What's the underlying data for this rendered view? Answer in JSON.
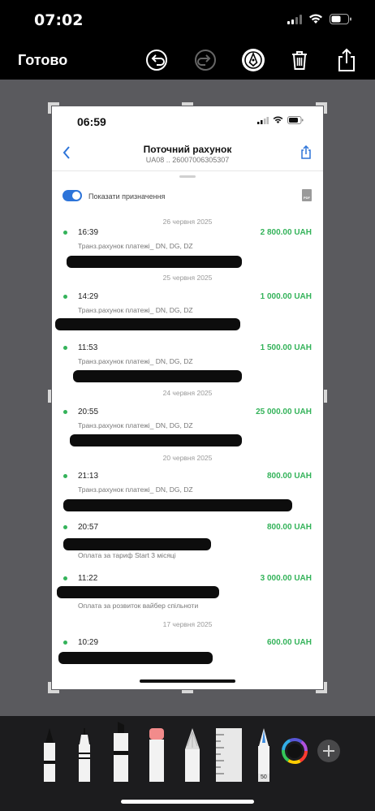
{
  "status_bar": {
    "time": "07:02"
  },
  "toolbar": {
    "done_label": "Готово"
  },
  "document": {
    "status_time": "06:59",
    "header": {
      "title": "Поточний рахунок",
      "subtitle": "UA08 .. 26007006305307"
    },
    "toggle_label": "Показати призначення",
    "pdf_label": "PDF",
    "dates": [
      "26 червня 2025",
      "25 червня 2025",
      "24 червня 2025",
      "20 червня 2025",
      "17 червня 2025"
    ],
    "transactions": [
      {
        "time": "16:39",
        "amount": "2 800.00 UAH",
        "desc": "Транз.рахунок платежі_ DN, DG, DZ"
      },
      {
        "time": "14:29",
        "amount": "1 000.00 UAH",
        "desc": "Транз.рахунок платежі_ DN, DG, DZ"
      },
      {
        "time": "11:53",
        "amount": "1 500.00 UAH",
        "desc": "Транз.рахунок платежі_ DN, DG, DZ"
      },
      {
        "time": "20:55",
        "amount": "25 000.00 UAH",
        "desc": "Транз.рахунок платежі_ DN, DG, DZ"
      },
      {
        "time": "21:13",
        "amount": "800.00 UAH",
        "desc": "Транз.рахунок платежі_ DN, DG, DZ"
      },
      {
        "time": "20:57",
        "amount": "800.00 UAH",
        "desc": "Оплата за тариф Start 3 місяці"
      },
      {
        "time": "11:22",
        "amount": "3 000.00 UAH",
        "desc": "Оплата за розвиток вайбер спільноти"
      },
      {
        "time": "10:29",
        "amount": "600.00 UAH",
        "desc": ""
      }
    ]
  },
  "tools": {
    "ruler_value": "50",
    "items": [
      "pen-tool",
      "monoline-tool",
      "marker-tool",
      "eraser-tool",
      "lasso-tool",
      "ruler-tool",
      "fountain-pen-tool",
      "color-picker",
      "add-tool-button"
    ]
  },
  "colors": {
    "accent_blue": "#2d74d9",
    "amount_green": "#34b35a",
    "canvas_gray": "#5a5a5e",
    "tray": "#1c1c1e"
  }
}
